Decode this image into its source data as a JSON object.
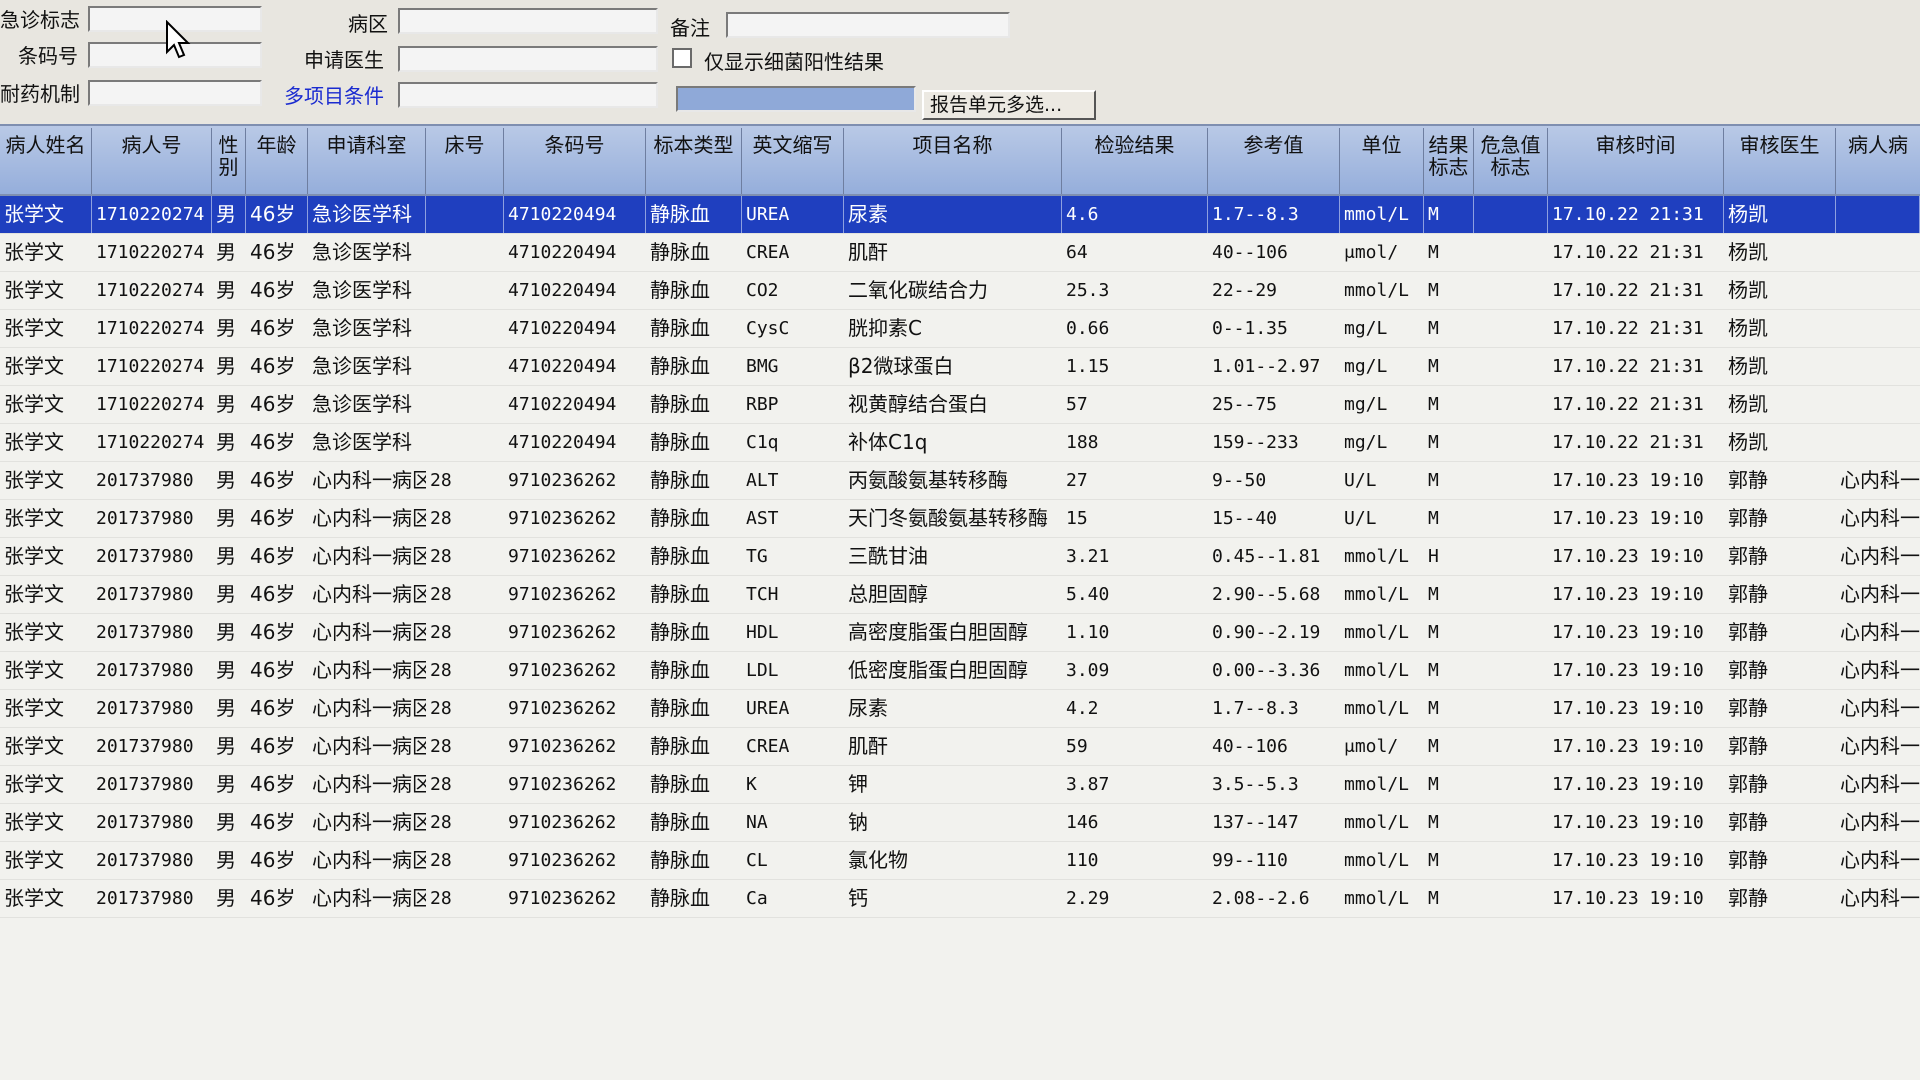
{
  "filters": {
    "emergency_flag": "急诊标志",
    "barcode": "条码号",
    "resistance": "耐药机制",
    "ward": "病区",
    "requesting_doctor": "申请医生",
    "multi_condition": "多项目条件",
    "remark": "备注",
    "bacteria_positive_only": "仅显示细菌阳性结果",
    "report_unit_button": "报告单元多选..."
  },
  "columns": {
    "name": "病人姓名",
    "pid": "病人号",
    "sex": "性别",
    "age": "年龄",
    "dept": "申请科室",
    "bed": "床号",
    "barcode": "条码号",
    "specimen": "标本类型",
    "abbr": "英文缩写",
    "item": "项目名称",
    "result": "检验结果",
    "ref": "参考值",
    "unit": "单位",
    "flag": "结果标志",
    "crit": "危急值标志",
    "time": "审核时间",
    "doctor": "审核医生",
    "ward": "病人病"
  },
  "rows": [
    {
      "name": "张学文",
      "pid": "1710220274",
      "sex": "男",
      "age": "46岁",
      "dept": "急诊医学科",
      "bed": "",
      "barcode": "4710220494",
      "specimen": "静脉血",
      "abbr": "UREA",
      "item": "尿素",
      "result": "4.6",
      "ref": "1.7--8.3",
      "unit": "mmol/L",
      "flag": "M",
      "crit": "",
      "time": "17.10.22 21:31",
      "doctor": "杨凯",
      "ward": ""
    },
    {
      "name": "张学文",
      "pid": "1710220274",
      "sex": "男",
      "age": "46岁",
      "dept": "急诊医学科",
      "bed": "",
      "barcode": "4710220494",
      "specimen": "静脉血",
      "abbr": "CREA",
      "item": "肌酐",
      "result": "64",
      "ref": "40--106",
      "unit": "μmol/",
      "flag": "M",
      "crit": "",
      "time": "17.10.22 21:31",
      "doctor": "杨凯",
      "ward": ""
    },
    {
      "name": "张学文",
      "pid": "1710220274",
      "sex": "男",
      "age": "46岁",
      "dept": "急诊医学科",
      "bed": "",
      "barcode": "4710220494",
      "specimen": "静脉血",
      "abbr": "CO2",
      "item": "二氧化碳结合力",
      "result": "25.3",
      "ref": "22--29",
      "unit": "mmol/L",
      "flag": "M",
      "crit": "",
      "time": "17.10.22 21:31",
      "doctor": "杨凯",
      "ward": ""
    },
    {
      "name": "张学文",
      "pid": "1710220274",
      "sex": "男",
      "age": "46岁",
      "dept": "急诊医学科",
      "bed": "",
      "barcode": "4710220494",
      "specimen": "静脉血",
      "abbr": "CysC",
      "item": "胱抑素C",
      "result": "0.66",
      "ref": "0--1.35",
      "unit": "mg/L",
      "flag": "M",
      "crit": "",
      "time": "17.10.22 21:31",
      "doctor": "杨凯",
      "ward": ""
    },
    {
      "name": "张学文",
      "pid": "1710220274",
      "sex": "男",
      "age": "46岁",
      "dept": "急诊医学科",
      "bed": "",
      "barcode": "4710220494",
      "specimen": "静脉血",
      "abbr": "BMG",
      "item": "β2微球蛋白",
      "result": "1.15",
      "ref": "1.01--2.97",
      "unit": "mg/L",
      "flag": "M",
      "crit": "",
      "time": "17.10.22 21:31",
      "doctor": "杨凯",
      "ward": ""
    },
    {
      "name": "张学文",
      "pid": "1710220274",
      "sex": "男",
      "age": "46岁",
      "dept": "急诊医学科",
      "bed": "",
      "barcode": "4710220494",
      "specimen": "静脉血",
      "abbr": "RBP",
      "item": "视黄醇结合蛋白",
      "result": "57",
      "ref": "25--75",
      "unit": "mg/L",
      "flag": "M",
      "crit": "",
      "time": "17.10.22 21:31",
      "doctor": "杨凯",
      "ward": ""
    },
    {
      "name": "张学文",
      "pid": "1710220274",
      "sex": "男",
      "age": "46岁",
      "dept": "急诊医学科",
      "bed": "",
      "barcode": "4710220494",
      "specimen": "静脉血",
      "abbr": "C1q",
      "item": "补体C1q",
      "result": "188",
      "ref": "159--233",
      "unit": "mg/L",
      "flag": "M",
      "crit": "",
      "time": "17.10.22 21:31",
      "doctor": "杨凯",
      "ward": ""
    },
    {
      "name": "张学文",
      "pid": "201737980",
      "sex": "男",
      "age": "46岁",
      "dept": "心内科一病区",
      "bed": "28",
      "barcode": "9710236262",
      "specimen": "静脉血",
      "abbr": "ALT",
      "item": "丙氨酸氨基转移酶",
      "result": "27",
      "ref": "9--50",
      "unit": "U/L",
      "flag": "M",
      "crit": "",
      "time": "17.10.23 19:10",
      "doctor": "郭静",
      "ward": "心内科一病"
    },
    {
      "name": "张学文",
      "pid": "201737980",
      "sex": "男",
      "age": "46岁",
      "dept": "心内科一病区",
      "bed": "28",
      "barcode": "9710236262",
      "specimen": "静脉血",
      "abbr": "AST",
      "item": "天门冬氨酸氨基转移酶",
      "result": "15",
      "ref": "15--40",
      "unit": "U/L",
      "flag": "M",
      "crit": "",
      "time": "17.10.23 19:10",
      "doctor": "郭静",
      "ward": "心内科一病"
    },
    {
      "name": "张学文",
      "pid": "201737980",
      "sex": "男",
      "age": "46岁",
      "dept": "心内科一病区",
      "bed": "28",
      "barcode": "9710236262",
      "specimen": "静脉血",
      "abbr": "TG",
      "item": "三酰甘油",
      "result": "3.21",
      "ref": "0.45--1.81",
      "unit": "mmol/L",
      "flag": "H",
      "crit": "",
      "time": "17.10.23 19:10",
      "doctor": "郭静",
      "ward": "心内科一病"
    },
    {
      "name": "张学文",
      "pid": "201737980",
      "sex": "男",
      "age": "46岁",
      "dept": "心内科一病区",
      "bed": "28",
      "barcode": "9710236262",
      "specimen": "静脉血",
      "abbr": "TCH",
      "item": "总胆固醇",
      "result": "5.40",
      "ref": "2.90--5.68",
      "unit": "mmol/L",
      "flag": "M",
      "crit": "",
      "time": "17.10.23 19:10",
      "doctor": "郭静",
      "ward": "心内科一病"
    },
    {
      "name": "张学文",
      "pid": "201737980",
      "sex": "男",
      "age": "46岁",
      "dept": "心内科一病区",
      "bed": "28",
      "barcode": "9710236262",
      "specimen": "静脉血",
      "abbr": "HDL",
      "item": "高密度脂蛋白胆固醇",
      "result": "1.10",
      "ref": "0.90--2.19",
      "unit": "mmol/L",
      "flag": "M",
      "crit": "",
      "time": "17.10.23 19:10",
      "doctor": "郭静",
      "ward": "心内科一病"
    },
    {
      "name": "张学文",
      "pid": "201737980",
      "sex": "男",
      "age": "46岁",
      "dept": "心内科一病区",
      "bed": "28",
      "barcode": "9710236262",
      "specimen": "静脉血",
      "abbr": "LDL",
      "item": "低密度脂蛋白胆固醇",
      "result": "3.09",
      "ref": "0.00--3.36",
      "unit": "mmol/L",
      "flag": "M",
      "crit": "",
      "time": "17.10.23 19:10",
      "doctor": "郭静",
      "ward": "心内科一病"
    },
    {
      "name": "张学文",
      "pid": "201737980",
      "sex": "男",
      "age": "46岁",
      "dept": "心内科一病区",
      "bed": "28",
      "barcode": "9710236262",
      "specimen": "静脉血",
      "abbr": "UREA",
      "item": "尿素",
      "result": "4.2",
      "ref": "1.7--8.3",
      "unit": "mmol/L",
      "flag": "M",
      "crit": "",
      "time": "17.10.23 19:10",
      "doctor": "郭静",
      "ward": "心内科一病"
    },
    {
      "name": "张学文",
      "pid": "201737980",
      "sex": "男",
      "age": "46岁",
      "dept": "心内科一病区",
      "bed": "28",
      "barcode": "9710236262",
      "specimen": "静脉血",
      "abbr": "CREA",
      "item": "肌酐",
      "result": "59",
      "ref": "40--106",
      "unit": "μmol/",
      "flag": "M",
      "crit": "",
      "time": "17.10.23 19:10",
      "doctor": "郭静",
      "ward": "心内科一病"
    },
    {
      "name": "张学文",
      "pid": "201737980",
      "sex": "男",
      "age": "46岁",
      "dept": "心内科一病区",
      "bed": "28",
      "barcode": "9710236262",
      "specimen": "静脉血",
      "abbr": "K",
      "item": "钾",
      "result": "3.87",
      "ref": "3.5--5.3",
      "unit": "mmol/L",
      "flag": "M",
      "crit": "",
      "time": "17.10.23 19:10",
      "doctor": "郭静",
      "ward": "心内科一病"
    },
    {
      "name": "张学文",
      "pid": "201737980",
      "sex": "男",
      "age": "46岁",
      "dept": "心内科一病区",
      "bed": "28",
      "barcode": "9710236262",
      "specimen": "静脉血",
      "abbr": "NA",
      "item": "钠",
      "result": "146",
      "ref": "137--147",
      "unit": "mmol/L",
      "flag": "M",
      "crit": "",
      "time": "17.10.23 19:10",
      "doctor": "郭静",
      "ward": "心内科一病"
    },
    {
      "name": "张学文",
      "pid": "201737980",
      "sex": "男",
      "age": "46岁",
      "dept": "心内科一病区",
      "bed": "28",
      "barcode": "9710236262",
      "specimen": "静脉血",
      "abbr": "CL",
      "item": "氯化物",
      "result": "110",
      "ref": "99--110",
      "unit": "mmol/L",
      "flag": "M",
      "crit": "",
      "time": "17.10.23 19:10",
      "doctor": "郭静",
      "ward": "心内科一病"
    },
    {
      "name": "张学文",
      "pid": "201737980",
      "sex": "男",
      "age": "46岁",
      "dept": "心内科一病区",
      "bed": "28",
      "barcode": "9710236262",
      "specimen": "静脉血",
      "abbr": "Ca",
      "item": "钙",
      "result": "2.29",
      "ref": "2.08--2.6",
      "unit": "mmol/L",
      "flag": "M",
      "crit": "",
      "time": "17.10.23 19:10",
      "doctor": "郭静",
      "ward": "心内科一病"
    }
  ],
  "colors": {
    "selected_row": "#1f3fbf",
    "header": "#95aedb"
  },
  "cursor_icon": "arrow-cursor-icon"
}
